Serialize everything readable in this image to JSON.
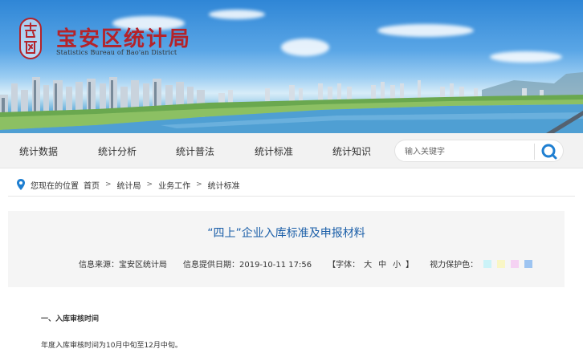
{
  "site": {
    "title": "宝安区统计局",
    "subtitle": "Statistics Bureau of Bao'an District"
  },
  "nav": {
    "items": [
      "统计数据",
      "统计分析",
      "统计普法",
      "统计标准",
      "统计知识"
    ],
    "search_placeholder": "输入关键字"
  },
  "breadcrumb": {
    "prefix": "您现在的位置",
    "items": [
      "首页",
      "统计局",
      "业务工作",
      "统计标准"
    ]
  },
  "article": {
    "title": "“四上”企业入库标准及申报材料",
    "source": "信息来源：宝安区统计局",
    "date": "信息提供日期：2019-10-11 17:56",
    "font_label": "【字体：",
    "font_sizes": [
      "大",
      "中",
      "小"
    ],
    "font_close": "】",
    "eye_label": "视力保护色：",
    "eye_colors": [
      "#cbf3f8",
      "#f9f6c5",
      "#f5d2f3",
      "#9dc4f1"
    ]
  },
  "content": {
    "heading": "一、入库审核时间",
    "paragraph": "年度入库审核时间为10月中旬至12月中旬。"
  },
  "colors": {
    "brand_red": "#b4232a",
    "title_blue": "#1a5ea8",
    "search_blue": "#1f7fd1"
  }
}
